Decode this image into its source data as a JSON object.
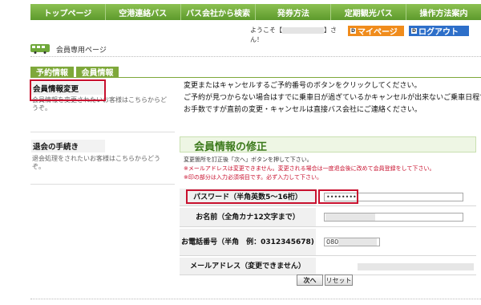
{
  "nav": {
    "items": [
      {
        "label": "トップページ"
      },
      {
        "label": "空港連絡バス"
      },
      {
        "label": "バス会社から検索"
      },
      {
        "label": "発券方法"
      },
      {
        "label": "定期観光バス"
      },
      {
        "label": "操作方法案内"
      }
    ]
  },
  "header": {
    "page_title": "会員専用ページ",
    "welcome_prefix": "ようこそ【",
    "welcome_suffix": "】さん！",
    "mypage_label": "マイページ",
    "logout_label": "ログアウト"
  },
  "tabs": [
    {
      "label": "予約情報"
    },
    {
      "label": "会員情報"
    }
  ],
  "sidebar": {
    "sections": [
      {
        "title": "会員情報変更",
        "desc": "会員情報を変更されたいお客様はこちらからどうぞ。"
      },
      {
        "title": "退会の手続き",
        "desc": "退会処理をされたいお客様はこちらからどうぞ。"
      }
    ]
  },
  "instructions": [
    "変更またはキャンセルするご予約番号のボタンをクリックしてください。",
    "ご予約が見つからない場合はすでに乗車日が過ぎているかキャンセルが出来ないご乗車日程です。",
    "お手数ですが直前の変更・キャンセルは直接バス会社にご連絡ください。"
  ],
  "form": {
    "title": "会員情報の修正",
    "notes": [
      "変更箇所を訂正後「次へ」ボタンを押して下さい。",
      "※メールアドレスは変更できません。変更される場合は一度退会後に改めて会員登録をして下さい。",
      "※印の部分は入力必須項目です。必ず入力して下さい。"
    ],
    "rows": [
      {
        "label": "パスワード（半角英数5～16桁）",
        "value": "••••••••"
      },
      {
        "label": "お名前（全角カナ12文字まで）",
        "value": ""
      },
      {
        "label": "お電話番号（半角　例：0312345678)",
        "value": "080"
      },
      {
        "label": "メールアドレス（変更できません）",
        "value": ""
      }
    ],
    "next_label": "次へ",
    "reset_label": "リセット"
  },
  "colors": {
    "nav_green": "#6fa83a",
    "tab_green": "#7ea83a",
    "title_green": "#3c7a1c",
    "mypage_orange": "#f08c1c",
    "logout_blue": "#2d6fc9",
    "highlight_red": "#c8102e"
  },
  "icons": {
    "bus": "bus-icon"
  }
}
